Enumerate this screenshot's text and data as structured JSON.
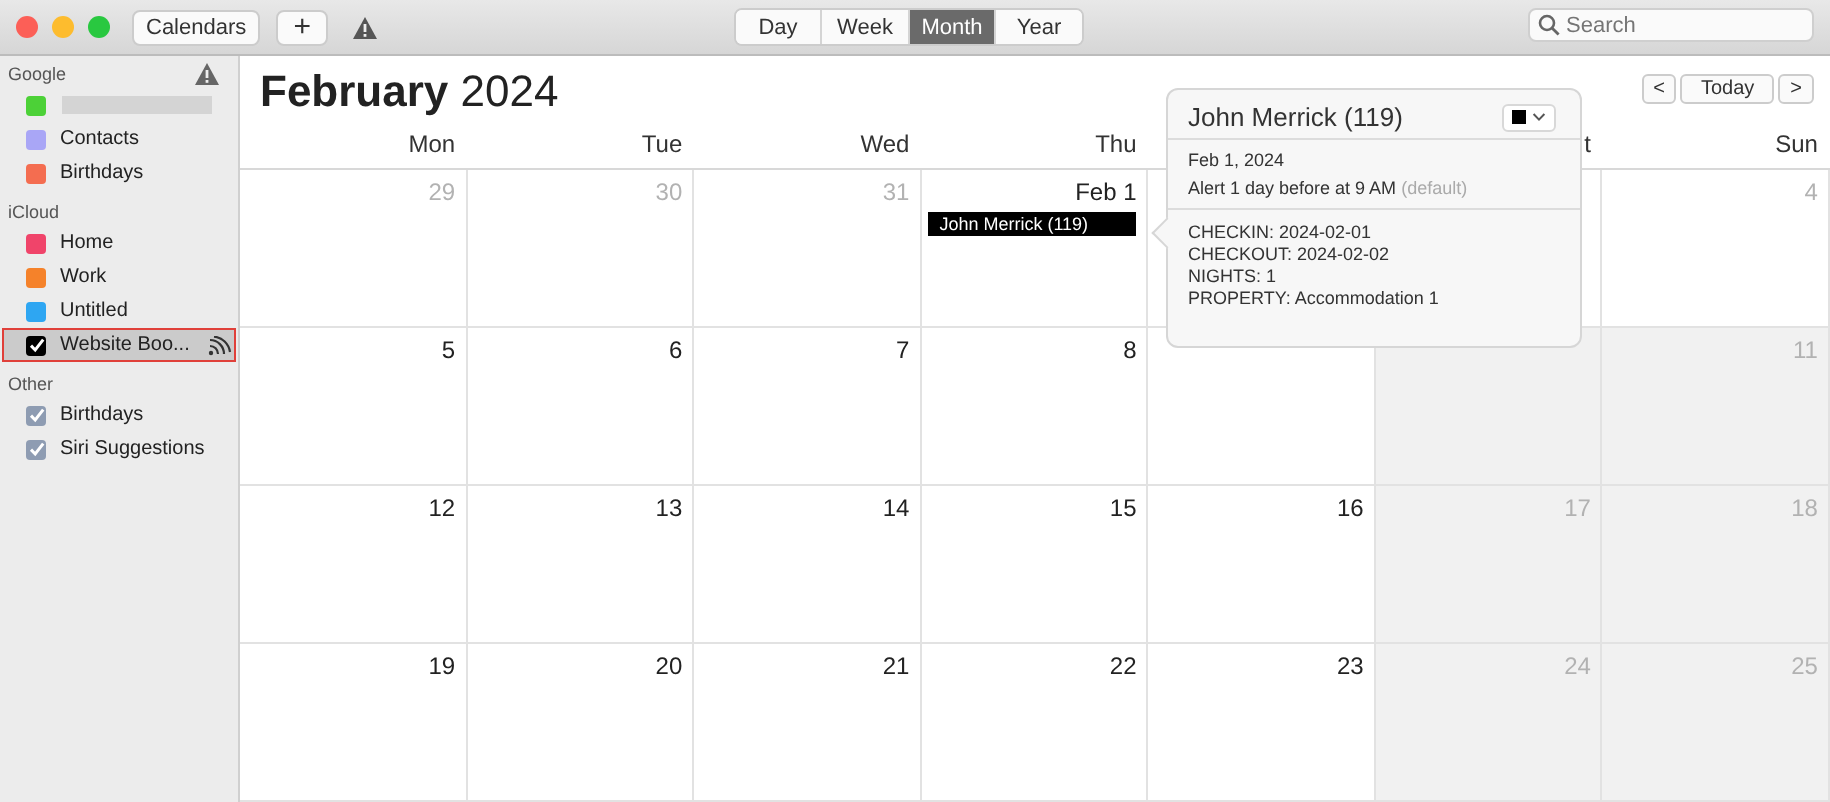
{
  "toolbar": {
    "calendars_button": "Calendars",
    "add_button": "+",
    "views": [
      {
        "label": "Day",
        "selected": false
      },
      {
        "label": "Week",
        "selected": false
      },
      {
        "label": "Month",
        "selected": true
      },
      {
        "label": "Year",
        "selected": false
      }
    ],
    "search": {
      "placeholder": "Search"
    }
  },
  "sidebar": {
    "groups": [
      {
        "title": "Google",
        "warning": true,
        "items": [
          {
            "kind": "redacted",
            "color": "#4cd137",
            "selected": false
          },
          {
            "kind": "swatch",
            "name": "Contacts",
            "color": "#a9a6f6",
            "selected": false
          },
          {
            "kind": "swatch",
            "name": "Birthdays",
            "color": "#f46d50",
            "selected": false
          }
        ]
      },
      {
        "title": "iCloud",
        "warning": false,
        "items": [
          {
            "kind": "swatch",
            "name": "Home",
            "color": "#f0446a",
            "selected": false
          },
          {
            "kind": "swatch",
            "name": "Work",
            "color": "#f5822a",
            "selected": false
          },
          {
            "kind": "swatch",
            "name": "Untitled",
            "color": "#2ea6f2",
            "selected": false
          },
          {
            "kind": "checkbox",
            "name": "Website Boo...",
            "color": "#000000",
            "selected": true,
            "checked": true,
            "subscribed": true
          }
        ]
      },
      {
        "title": "Other",
        "warning": false,
        "items": [
          {
            "kind": "checkbox",
            "name": "Birthdays",
            "color": "#8e9cb2",
            "selected": false,
            "checked": true
          },
          {
            "kind": "checkbox",
            "name": "Siri Suggestions",
            "color": "#8e9cb2",
            "selected": false,
            "checked": true
          }
        ]
      }
    ]
  },
  "calendar": {
    "month": "February",
    "year": "2024",
    "today_button": "Today",
    "prev_button": "<",
    "next_button": ">",
    "weekdays": [
      {
        "label": "Mon",
        "hidden": false
      },
      {
        "label": "Tue",
        "hidden": false
      },
      {
        "label": "Wed",
        "hidden": false
      },
      {
        "label": "Thu",
        "hidden": false
      },
      {
        "hidden": true
      },
      {
        "label": "t",
        "hidden": false
      },
      {
        "label": "Sun",
        "hidden": false
      }
    ],
    "weeks": [
      [
        {
          "day": "29",
          "dim": true,
          "weekend": false
        },
        {
          "day": "30",
          "dim": true,
          "weekend": false
        },
        {
          "day": "31",
          "dim": true,
          "weekend": false
        },
        {
          "day": "Feb 1",
          "dim": false,
          "weekend": false,
          "events": [
            "John Merrick (119)"
          ]
        },
        {
          "weekend": false
        },
        {
          "weekend": false
        },
        {
          "day": "4",
          "dim": true,
          "weekend": false
        }
      ],
      [
        {
          "day": "5",
          "dim": false,
          "weekend": false
        },
        {
          "day": "6",
          "dim": false,
          "weekend": false
        },
        {
          "day": "7",
          "dim": false,
          "weekend": false
        },
        {
          "day": "8",
          "dim": false,
          "weekend": false
        },
        {
          "weekend": false
        },
        {
          "weekend": true
        },
        {
          "day": "11",
          "dim": true,
          "weekend": true
        }
      ],
      [
        {
          "day": "12",
          "dim": false,
          "weekend": false
        },
        {
          "day": "13",
          "dim": false,
          "weekend": false
        },
        {
          "day": "14",
          "dim": false,
          "weekend": false
        },
        {
          "day": "15",
          "dim": false,
          "weekend": false
        },
        {
          "day": "16",
          "dim": false,
          "weekend": false
        },
        {
          "day": "17",
          "dim": true,
          "weekend": true
        },
        {
          "day": "18",
          "dim": true,
          "weekend": true
        }
      ],
      [
        {
          "day": "19",
          "dim": false,
          "weekend": false
        },
        {
          "day": "20",
          "dim": false,
          "weekend": false
        },
        {
          "day": "21",
          "dim": false,
          "weekend": false
        },
        {
          "day": "22",
          "dim": false,
          "weekend": false
        },
        {
          "day": "23",
          "dim": false,
          "weekend": false
        },
        {
          "day": "24",
          "dim": true,
          "weekend": true
        },
        {
          "day": "25",
          "dim": true,
          "weekend": true
        }
      ]
    ]
  },
  "popover": {
    "title": "John Merrick (119)",
    "color": "#000000",
    "date": "Feb 1, 2024",
    "alert": "Alert 1 day before at 9 AM",
    "alert_note": "(default)",
    "notes": [
      "CHECKIN: 2024-02-01",
      "CHECKOUT: 2024-02-02",
      "NIGHTS: 1",
      "PROPERTY: Accommodation 1"
    ]
  }
}
